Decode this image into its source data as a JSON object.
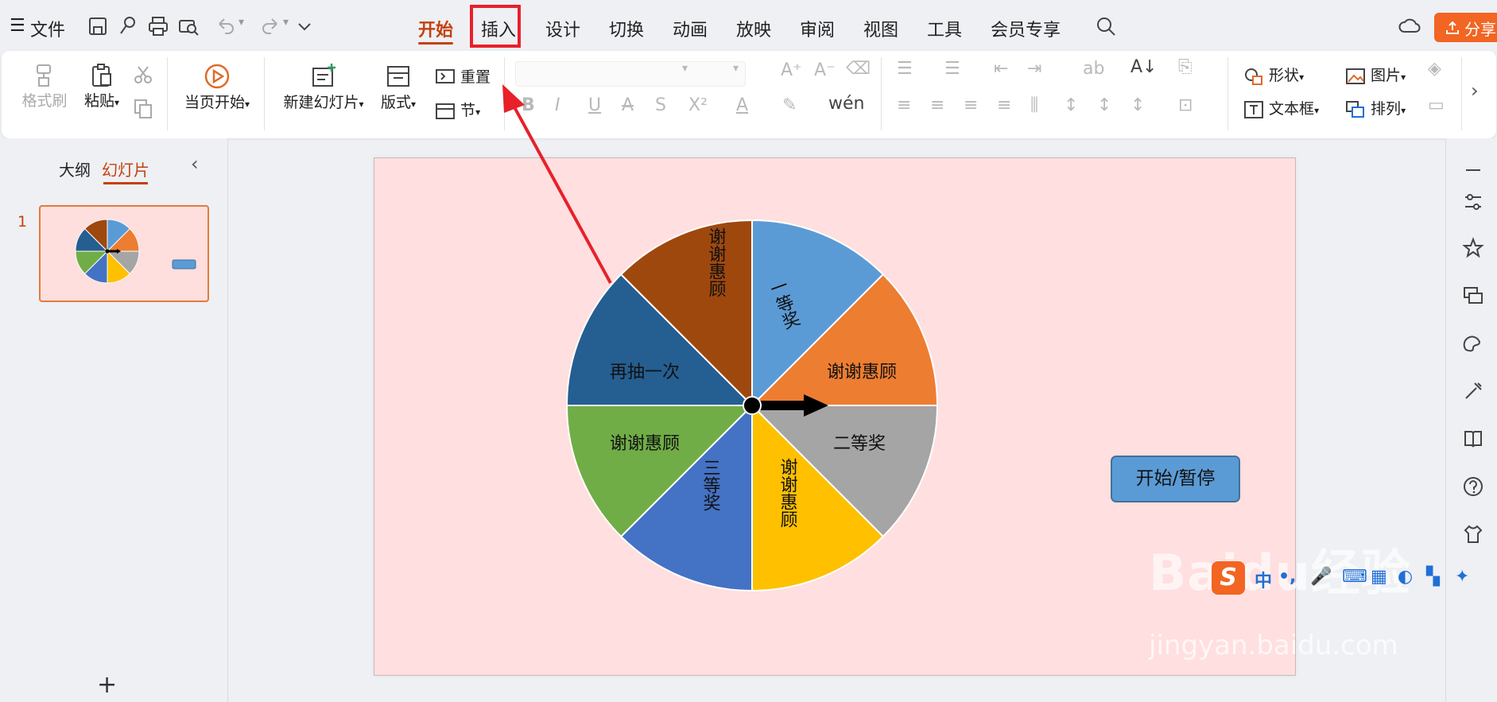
{
  "topbar": {
    "menu_label": "文件",
    "tabs": [
      {
        "label": "开始"
      },
      {
        "label": "插入"
      },
      {
        "label": "设计"
      },
      {
        "label": "切换"
      },
      {
        "label": "动画"
      },
      {
        "label": "放映"
      },
      {
        "label": "审阅"
      },
      {
        "label": "视图"
      },
      {
        "label": "工具"
      },
      {
        "label": "会员专享"
      }
    ],
    "share_label": "分享"
  },
  "ribbon": {
    "format_painter": "格式刷",
    "paste": "粘贴",
    "start_from_current": "当页开始",
    "new_slide": "新建幻灯片",
    "layout": "版式",
    "reset": "重置",
    "section": "节",
    "shape": "形状",
    "picture": "图片",
    "textbox": "文本框",
    "arrange": "排列"
  },
  "panel": {
    "tab_outline": "大纲",
    "tab_slides": "幻灯片",
    "slide_number": "1"
  },
  "slide": {
    "wheel_labels": [
      "一等奖",
      "谢谢惠顾",
      "二等奖",
      "谢谢惠顾",
      "三等奖",
      "谢谢惠顾",
      "再抽一次",
      "谢谢惠顾"
    ],
    "start_button": "开始/暂停",
    "colors": {
      "blue": "#5b9bd5",
      "orange": "#ed7d31",
      "gray": "#a5a5a5",
      "gold": "#ffc000",
      "royal": "#4472c4",
      "green": "#70ad47",
      "navy": "#255e91",
      "brown": "#9e480e",
      "background": "#ffdfdf"
    }
  },
  "overlay": {
    "watermark": "Baidu经验",
    "watermark_url": "jingyan.baidu.com",
    "ime_label": "中"
  }
}
